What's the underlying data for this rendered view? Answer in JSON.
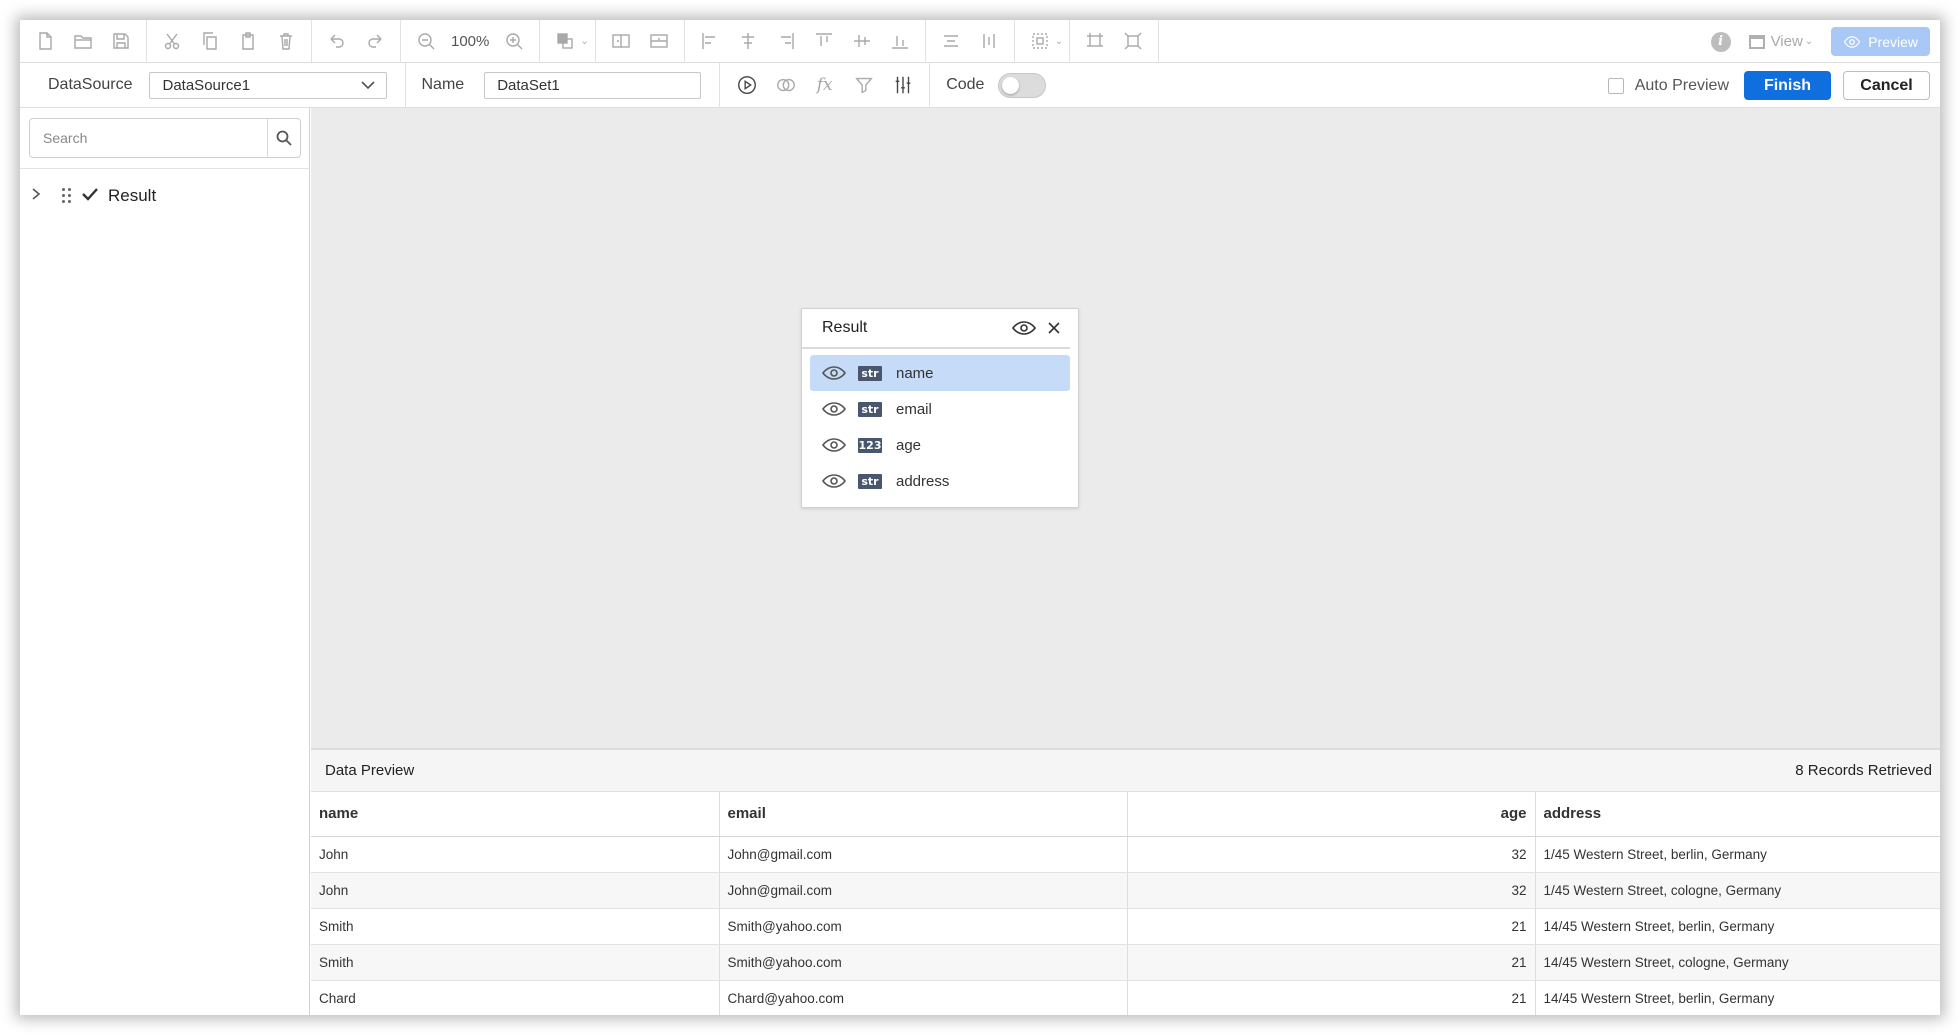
{
  "toolbar": {
    "zoom": "100%",
    "view_label": "View",
    "preview_label": "Preview"
  },
  "datasource": {
    "label": "DataSource",
    "value": "DataSource1"
  },
  "name": {
    "label": "Name",
    "value": "DataSet1"
  },
  "code": {
    "label": "Code"
  },
  "auto_preview_label": "Auto Preview",
  "finish_label": "Finish",
  "cancel_label": "Cancel",
  "sidebar": {
    "search_placeholder": "Search",
    "tree_item": "Result"
  },
  "result_box": {
    "title": "Result",
    "fields": [
      {
        "type": "str",
        "name": "name"
      },
      {
        "type": "str",
        "name": "email"
      },
      {
        "type": "123",
        "name": "age"
      },
      {
        "type": "str",
        "name": "address"
      }
    ]
  },
  "data_preview": {
    "title": "Data Preview",
    "count": "8 Records Retrieved",
    "columns": [
      "name",
      "email",
      "age",
      "address"
    ],
    "rows": [
      [
        "John",
        "John@gmail.com",
        "32",
        "1/45 Western Street, berlin, Germany"
      ],
      [
        "John",
        "John@gmail.com",
        "32",
        "1/45 Western Street, cologne, Germany"
      ],
      [
        "Smith",
        "Smith@yahoo.com",
        "21",
        "14/45 Western Street, berlin, Germany"
      ],
      [
        "Smith",
        "Smith@yahoo.com",
        "21",
        "14/45 Western Street, cologne, Germany"
      ],
      [
        "Chard",
        "Chard@yahoo.com",
        "21",
        "14/45 Western Street, berlin, Germany"
      ]
    ]
  },
  "colors": {
    "accent": "#0f6fde",
    "preview_disabled": "#a9c8f5",
    "selected_row": "#c6dbf8",
    "canvas": "#ebebeb"
  }
}
